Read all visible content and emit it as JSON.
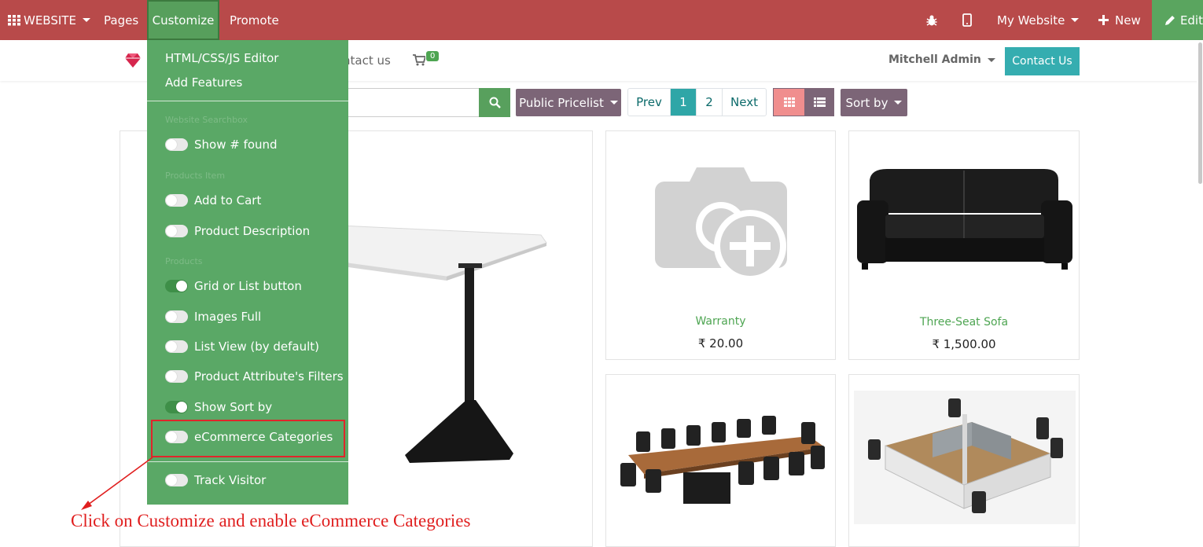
{
  "colors": {
    "admin_bar": "#b84a4a",
    "dropdown": "#5aa866",
    "accent_teal": "#2fa6a7",
    "mauve": "#7c6577",
    "annotation": "#e01f1f"
  },
  "topbar": {
    "apps_icon": "grid-icon",
    "website_label": "WEBSITE",
    "pages_label": "Pages",
    "customize_label": "Customize",
    "promote_label": "Promote",
    "debug_icon": "bug-icon",
    "mobile_icon": "mobile-icon",
    "my_website_label": "My Website",
    "new_label": "New",
    "edit_label": "Edit"
  },
  "header": {
    "contact_us_nav": "ntact us",
    "cart_count": "0",
    "user_label": "Mitchell Admin",
    "contact_button": "Contact Us"
  },
  "toolbar": {
    "pricelist_label": "Public Pricelist",
    "pager": {
      "prev": "Prev",
      "pages": [
        "1",
        "2"
      ],
      "active_page": "1",
      "next": "Next"
    },
    "view_grid_icon": "grid-view-icon",
    "view_list_icon": "list-view-icon",
    "sort_label": "Sort by"
  },
  "products": [
    {
      "name": "Warranty",
      "price": "₹ 20.00"
    },
    {
      "name": "Three-Seat Sofa",
      "price": "₹ 1,500.00"
    }
  ],
  "dropdown": {
    "links": [
      "HTML/CSS/JS Editor",
      "Add Features"
    ],
    "sections": [
      {
        "header": "Website Searchbox",
        "options": [
          {
            "label": "Show # found",
            "enabled": false
          }
        ]
      },
      {
        "header": "Products Item",
        "options": [
          {
            "label": "Add to Cart",
            "enabled": false
          },
          {
            "label": "Product Description",
            "enabled": false
          }
        ]
      },
      {
        "header": "Products",
        "options": [
          {
            "label": "Grid or List button",
            "enabled": true
          },
          {
            "label": "Images Full",
            "enabled": false
          },
          {
            "label": "List View (by default)",
            "enabled": false
          },
          {
            "label": "Product Attribute's Filters",
            "enabled": false
          },
          {
            "label": "Show Sort by",
            "enabled": true
          },
          {
            "label": "eCommerce Categories",
            "enabled": false
          }
        ]
      },
      {
        "header": "",
        "options": [
          {
            "label": "Track Visitor",
            "enabled": false
          }
        ]
      }
    ]
  },
  "annotation": {
    "text": "Click on Customize and enable eCommerce Categories"
  }
}
